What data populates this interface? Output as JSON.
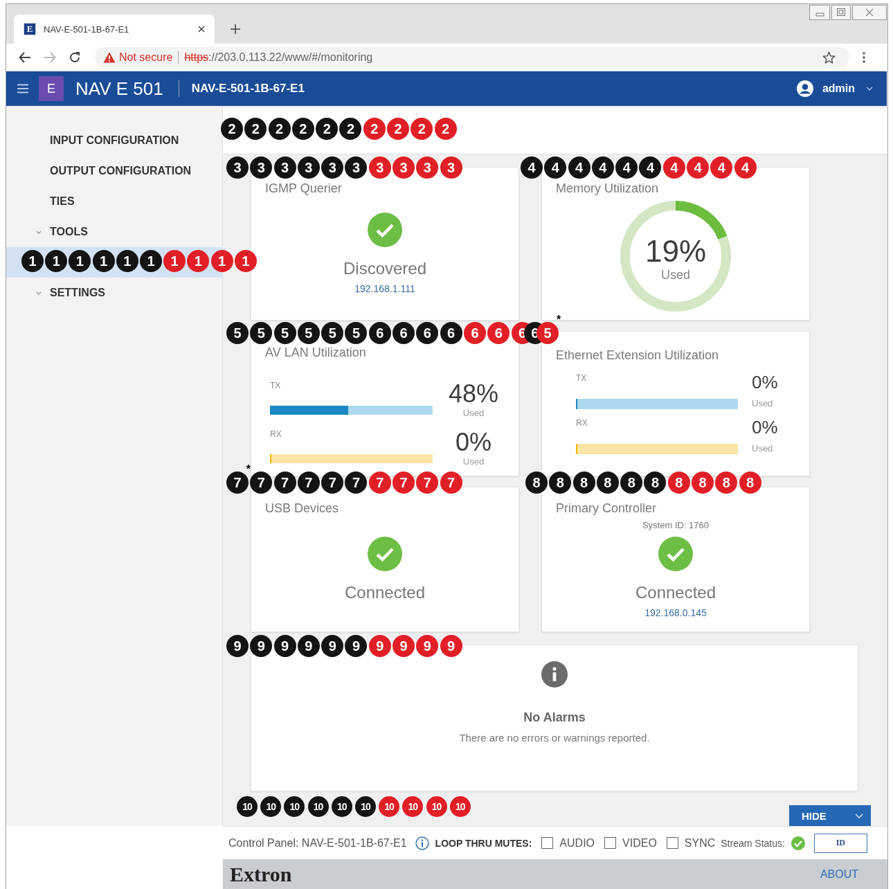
{
  "browser": {
    "tab": {
      "favicon": "E",
      "title": "NAV-E-501-1B-67-E1"
    },
    "forward_disabled": true,
    "address": {
      "secure": false,
      "security_label": "Not secure",
      "scheme": "https",
      "rest": "://203.0.113.22/www/#/monitoring"
    }
  },
  "header": {
    "logo": "E",
    "title": "NAV E 501",
    "device": "NAV-E-501-1B-67-E1",
    "user": "admin"
  },
  "sidebar": {
    "items": [
      {
        "label": "INPUT CONFIGURATION",
        "expandable": false,
        "selected": false
      },
      {
        "label": "OUTPUT CONFIGURATION",
        "expandable": false,
        "selected": false
      },
      {
        "label": "TIES",
        "expandable": false,
        "selected": false
      },
      {
        "label": "TOOLS",
        "expandable": true,
        "selected": false
      },
      {
        "expandable": false,
        "selected": true
      },
      {
        "label": "SETTINGS",
        "expandable": true,
        "selected": false
      }
    ]
  },
  "cards": [
    {
      "kind": "status",
      "title": "IGMP Querier",
      "ok": true,
      "status": "Discovered",
      "address": "192.168.1.111"
    },
    {
      "kind": "donut",
      "title": "Memory Utilization",
      "value": "19%",
      "caption": "Used",
      "level": 0.19
    },
    {
      "kind": "bars",
      "title": "AV LAN Utilization",
      "channels": [
        {
          "kind": "tx",
          "label": "TX",
          "value": "48%",
          "caption": "Used",
          "level": 0.48
        },
        {
          "kind": "rx",
          "label": "RX",
          "value": "0%",
          "caption": "Used",
          "level": 0
        }
      ]
    },
    {
      "kind": "bars-compact",
      "title": "Ethernet Extension Utilization",
      "channels": [
        {
          "kind": "tx",
          "label": "TX",
          "value": "0%",
          "caption": "Used",
          "level": 0
        },
        {
          "kind": "rx",
          "label": "RX",
          "value": "0%",
          "caption": "Used",
          "level": 0
        }
      ]
    },
    {
      "kind": "status",
      "title": "USB Devices",
      "ok": true,
      "status": "Connected"
    },
    {
      "kind": "status",
      "title": "Primary Controller",
      "system_id": "System ID: 1760",
      "ok": true,
      "status": "Connected",
      "address": "192.168.0.145"
    }
  ],
  "alarms": {
    "title": "No Alarms",
    "message": "There are no errors or warnings reported."
  },
  "hide_button": {
    "label": "HIDE"
  },
  "control_bar": {
    "panel": "Control Panel: NAV-E-501-1B-67-E1",
    "mutes_label": "LOOP THRU MUTES:",
    "mutes": [
      {
        "label": "AUDIO",
        "checked": false
      },
      {
        "label": "VIDEO",
        "checked": false
      },
      {
        "label": "SYNC",
        "checked": false
      }
    ],
    "stream_label": "Stream Status:",
    "stream_ok": true,
    "id_button": "ID"
  },
  "footer": {
    "brand": "Extron",
    "about": "ABOUT"
  },
  "callouts": [
    {
      "markers": [
        {
          "number": "1",
          "color": "#141414"
        },
        {
          "number": "1",
          "color": "#141414"
        },
        {
          "number": "1",
          "color": "#141414"
        },
        {
          "number": "1",
          "color": "#141414"
        },
        {
          "number": "1",
          "color": "#141414"
        },
        {
          "number": "1",
          "color": "#141414"
        },
        {
          "number": "1",
          "color": "#e21f26"
        },
        {
          "number": "1",
          "color": "#e21f26"
        },
        {
          "number": "1",
          "color": "#e21f26"
        },
        {
          "number": "1",
          "color": "#e21f26"
        }
      ]
    },
    {
      "markers": [
        {
          "number": "2",
          "color": "#141414"
        },
        {
          "number": "2",
          "color": "#141414"
        },
        {
          "number": "2",
          "color": "#141414"
        },
        {
          "number": "2",
          "color": "#141414"
        },
        {
          "number": "2",
          "color": "#141414"
        },
        {
          "number": "2",
          "color": "#141414"
        },
        {
          "number": "2",
          "color": "#e21f26"
        },
        {
          "number": "2",
          "color": "#e21f26"
        },
        {
          "number": "2",
          "color": "#e21f26"
        },
        {
          "number": "2",
          "color": "#e21f26"
        }
      ]
    },
    {
      "markers": [
        {
          "number": "3",
          "color": "#141414"
        },
        {
          "number": "3",
          "color": "#141414"
        },
        {
          "number": "3",
          "color": "#141414"
        },
        {
          "number": "3",
          "color": "#141414"
        },
        {
          "number": "3",
          "color": "#141414"
        },
        {
          "number": "3",
          "color": "#141414"
        },
        {
          "number": "3",
          "color": "#e21f26"
        },
        {
          "number": "3",
          "color": "#e21f26"
        },
        {
          "number": "3",
          "color": "#e21f26"
        },
        {
          "number": "3",
          "color": "#e21f26"
        }
      ]
    },
    {
      "markers": [
        {
          "number": "4",
          "color": "#141414"
        },
        {
          "number": "4",
          "color": "#141414"
        },
        {
          "number": "4",
          "color": "#141414"
        },
        {
          "number": "4",
          "color": "#141414"
        },
        {
          "number": "4",
          "color": "#141414"
        },
        {
          "number": "4",
          "color": "#141414"
        },
        {
          "number": "4",
          "color": "#e21f26"
        },
        {
          "number": "4",
          "color": "#e21f26"
        },
        {
          "number": "4",
          "color": "#e21f26"
        },
        {
          "number": "4",
          "color": "#e21f26"
        }
      ]
    },
    {
      "markers": [
        {
          "number": "5",
          "color": "#141414"
        },
        {
          "number": "5",
          "color": "#141414"
        },
        {
          "number": "5",
          "color": "#141414"
        },
        {
          "number": "5",
          "color": "#141414"
        },
        {
          "number": "5",
          "color": "#141414"
        },
        {
          "number": "5",
          "color": "#141414"
        },
        {
          "number": "6",
          "color": "#141414"
        },
        {
          "number": "6",
          "color": "#141414"
        },
        {
          "number": "6",
          "color": "#141414"
        },
        {
          "number": "6",
          "color": "#141414"
        },
        {
          "number": "6",
          "color": "#e21f26"
        },
        {
          "number": "6",
          "color": "#e21f26"
        },
        {
          "number": "6",
          "color": "#e21f26"
        },
        {
          "number": "6",
          "color": "#141414"
        },
        {
          "number": "5",
          "color": "#e21f26",
          "note": "*"
        }
      ]
    },
    {
      "markers": [
        {
          "number": "7",
          "color": "#141414",
          "note": "*"
        },
        {
          "number": "7",
          "color": "#141414"
        },
        {
          "number": "7",
          "color": "#141414"
        },
        {
          "number": "7",
          "color": "#141414"
        },
        {
          "number": "7",
          "color": "#141414"
        },
        {
          "number": "7",
          "color": "#141414"
        },
        {
          "number": "7",
          "color": "#e21f26"
        },
        {
          "number": "7",
          "color": "#e21f26"
        },
        {
          "number": "7",
          "color": "#e21f26"
        },
        {
          "number": "7",
          "color": "#e21f26"
        }
      ]
    },
    {
      "markers": [
        {
          "number": "8",
          "color": "#141414"
        },
        {
          "number": "8",
          "color": "#141414"
        },
        {
          "number": "8",
          "color": "#141414"
        },
        {
          "number": "8",
          "color": "#141414"
        },
        {
          "number": "8",
          "color": "#141414"
        },
        {
          "number": "8",
          "color": "#141414"
        },
        {
          "number": "8",
          "color": "#e21f26"
        },
        {
          "number": "8",
          "color": "#e21f26"
        },
        {
          "number": "8",
          "color": "#e21f26"
        },
        {
          "number": "8",
          "color": "#e21f26"
        }
      ]
    },
    {
      "markers": [
        {
          "number": "9",
          "color": "#141414"
        },
        {
          "number": "9",
          "color": "#141414"
        },
        {
          "number": "9",
          "color": "#141414"
        },
        {
          "number": "9",
          "color": "#141414"
        },
        {
          "number": "9",
          "color": "#141414"
        },
        {
          "number": "9",
          "color": "#141414"
        },
        {
          "number": "9",
          "color": "#e21f26"
        },
        {
          "number": "9",
          "color": "#e21f26"
        },
        {
          "number": "9",
          "color": "#e21f26"
        },
        {
          "number": "9",
          "color": "#e21f26"
        }
      ]
    },
    {
      "markers": [
        {
          "number": "10",
          "color": "#141414"
        },
        {
          "number": "10",
          "color": "#141414"
        },
        {
          "number": "10",
          "color": "#141414"
        },
        {
          "number": "10",
          "color": "#141414"
        },
        {
          "number": "10",
          "color": "#141414"
        },
        {
          "number": "10",
          "color": "#141414"
        },
        {
          "number": "10",
          "color": "#e21f26"
        },
        {
          "number": "10",
          "color": "#e21f26"
        },
        {
          "number": "10",
          "color": "#e21f26"
        },
        {
          "number": "10",
          "color": "#e21f26"
        }
      ]
    }
  ]
}
